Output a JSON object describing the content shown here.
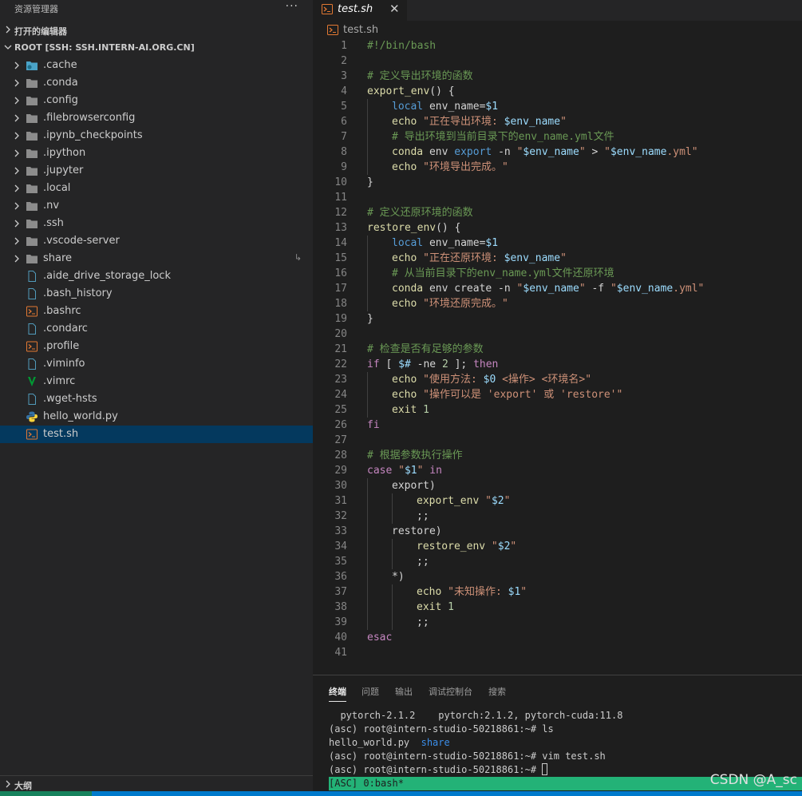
{
  "colors": {
    "accent": "#007acc",
    "selection": "#04395e",
    "tmux_bar": "#23b277",
    "remote": "#16825d"
  },
  "sidebar": {
    "title": "资源管理器",
    "more": "···",
    "open_editors": "打开的编辑器",
    "root": "ROOT [SSH: SSH.INTERN-AI.ORG.CN]",
    "outline": "大纲",
    "items": [
      {
        "name": ".cache",
        "type": "folder",
        "icon": "folder-cache-icon"
      },
      {
        "name": ".conda",
        "type": "folder",
        "icon": "folder-icon"
      },
      {
        "name": ".config",
        "type": "folder",
        "icon": "folder-icon"
      },
      {
        "name": ".filebrowserconfig",
        "type": "folder",
        "icon": "folder-icon"
      },
      {
        "name": ".ipynb_checkpoints",
        "type": "folder",
        "icon": "folder-icon"
      },
      {
        "name": ".ipython",
        "type": "folder",
        "icon": "folder-icon"
      },
      {
        "name": ".jupyter",
        "type": "folder",
        "icon": "folder-icon"
      },
      {
        "name": ".local",
        "type": "folder",
        "icon": "folder-icon"
      },
      {
        "name": ".nv",
        "type": "folder",
        "icon": "folder-icon"
      },
      {
        "name": ".ssh",
        "type": "folder",
        "icon": "folder-icon"
      },
      {
        "name": ".vscode-server",
        "type": "folder",
        "icon": "folder-icon"
      },
      {
        "name": "share",
        "type": "folder",
        "icon": "folder-icon",
        "badge": "↳"
      },
      {
        "name": ".aide_drive_storage_lock",
        "type": "file",
        "icon": "file-icon"
      },
      {
        "name": ".bash_history",
        "type": "file",
        "icon": "file-icon"
      },
      {
        "name": ".bashrc",
        "type": "file",
        "icon": "shell-icon"
      },
      {
        "name": ".condarc",
        "type": "file",
        "icon": "file-icon"
      },
      {
        "name": ".profile",
        "type": "file",
        "icon": "shell-icon"
      },
      {
        "name": ".viminfo",
        "type": "file",
        "icon": "file-icon"
      },
      {
        "name": ".vimrc",
        "type": "file",
        "icon": "vim-icon"
      },
      {
        "name": ".wget-hsts",
        "type": "file",
        "icon": "file-icon"
      },
      {
        "name": "hello_world.py",
        "type": "file",
        "icon": "python-icon"
      },
      {
        "name": "test.sh",
        "type": "file",
        "icon": "shell-icon",
        "selected": true
      }
    ]
  },
  "editor": {
    "tab_name": "test.sh",
    "tab_close": "✕",
    "breadcrumb": "test.sh",
    "lines": [
      {
        "n": "1",
        "indent": 0,
        "tokens": [
          [
            "cm",
            "#!/bin/bash"
          ]
        ]
      },
      {
        "n": "2",
        "indent": 0,
        "tokens": []
      },
      {
        "n": "3",
        "indent": 0,
        "tokens": [
          [
            "cm",
            "# 定义导出环境的函数"
          ]
        ]
      },
      {
        "n": "4",
        "indent": 0,
        "tokens": [
          [
            "fn",
            "export_env"
          ],
          [
            "pl",
            "() {"
          ]
        ]
      },
      {
        "n": "5",
        "indent": 1,
        "tokens": [
          [
            "bl",
            "local"
          ],
          [
            "pl",
            " env_name="
          ],
          [
            "var",
            "$1"
          ]
        ]
      },
      {
        "n": "6",
        "indent": 1,
        "tokens": [
          [
            "fn",
            "echo"
          ],
          [
            "pl",
            " "
          ],
          [
            "str",
            "\"正在导出环境: "
          ],
          [
            "var",
            "$env_name"
          ],
          [
            "str",
            "\""
          ]
        ]
      },
      {
        "n": "7",
        "indent": 1,
        "tokens": [
          [
            "cm",
            "# 导出环境到当前目录下的env_name.yml文件"
          ]
        ]
      },
      {
        "n": "8",
        "indent": 1,
        "tokens": [
          [
            "fn",
            "conda"
          ],
          [
            "pl",
            " env "
          ],
          [
            "bl",
            "export"
          ],
          [
            "pl",
            " -n "
          ],
          [
            "str",
            "\""
          ],
          [
            "var",
            "$env_name"
          ],
          [
            "str",
            "\""
          ],
          [
            "pl",
            " > "
          ],
          [
            "str",
            "\""
          ],
          [
            "var",
            "$env_name"
          ],
          [
            "str",
            ".yml\""
          ]
        ]
      },
      {
        "n": "9",
        "indent": 1,
        "tokens": [
          [
            "fn",
            "echo"
          ],
          [
            "pl",
            " "
          ],
          [
            "str",
            "\"环境导出完成。\""
          ]
        ]
      },
      {
        "n": "10",
        "indent": 0,
        "tokens": [
          [
            "pl",
            "}"
          ]
        ]
      },
      {
        "n": "11",
        "indent": 0,
        "tokens": []
      },
      {
        "n": "12",
        "indent": 0,
        "tokens": [
          [
            "cm",
            "# 定义还原环境的函数"
          ]
        ]
      },
      {
        "n": "13",
        "indent": 0,
        "tokens": [
          [
            "fn",
            "restore_env"
          ],
          [
            "pl",
            "() {"
          ]
        ]
      },
      {
        "n": "14",
        "indent": 1,
        "tokens": [
          [
            "bl",
            "local"
          ],
          [
            "pl",
            " env_name="
          ],
          [
            "var",
            "$1"
          ]
        ]
      },
      {
        "n": "15",
        "indent": 1,
        "tokens": [
          [
            "fn",
            "echo"
          ],
          [
            "pl",
            " "
          ],
          [
            "str",
            "\"正在还原环境: "
          ],
          [
            "var",
            "$env_name"
          ],
          [
            "str",
            "\""
          ]
        ]
      },
      {
        "n": "16",
        "indent": 1,
        "tokens": [
          [
            "cm",
            "# 从当前目录下的env_name.yml文件还原环境"
          ]
        ]
      },
      {
        "n": "17",
        "indent": 1,
        "tokens": [
          [
            "fn",
            "conda"
          ],
          [
            "pl",
            " env create -n "
          ],
          [
            "str",
            "\""
          ],
          [
            "var",
            "$env_name"
          ],
          [
            "str",
            "\""
          ],
          [
            "pl",
            " -f "
          ],
          [
            "str",
            "\""
          ],
          [
            "var",
            "$env_name"
          ],
          [
            "str",
            ".yml\""
          ]
        ]
      },
      {
        "n": "18",
        "indent": 1,
        "tokens": [
          [
            "fn",
            "echo"
          ],
          [
            "pl",
            " "
          ],
          [
            "str",
            "\"环境还原完成。\""
          ]
        ]
      },
      {
        "n": "19",
        "indent": 0,
        "tokens": [
          [
            "pl",
            "}"
          ]
        ]
      },
      {
        "n": "20",
        "indent": 0,
        "tokens": []
      },
      {
        "n": "21",
        "indent": 0,
        "tokens": [
          [
            "cm",
            "# 检查是否有足够的参数"
          ]
        ]
      },
      {
        "n": "22",
        "indent": 0,
        "tokens": [
          [
            "kw",
            "if"
          ],
          [
            "pl",
            " [ "
          ],
          [
            "var",
            "$#"
          ],
          [
            "pl",
            " -ne "
          ],
          [
            "num",
            "2"
          ],
          [
            "pl",
            " ]; "
          ],
          [
            "kw",
            "then"
          ]
        ]
      },
      {
        "n": "23",
        "indent": 1,
        "tokens": [
          [
            "fn",
            "echo"
          ],
          [
            "pl",
            " "
          ],
          [
            "str",
            "\"使用方法: "
          ],
          [
            "var",
            "$0"
          ],
          [
            "str",
            " <操作> <环境名>\""
          ]
        ]
      },
      {
        "n": "24",
        "indent": 1,
        "tokens": [
          [
            "fn",
            "echo"
          ],
          [
            "pl",
            " "
          ],
          [
            "str",
            "\"操作可以是 'export' 或 'restore'\""
          ]
        ]
      },
      {
        "n": "25",
        "indent": 1,
        "tokens": [
          [
            "fn",
            "exit"
          ],
          [
            "pl",
            " "
          ],
          [
            "num",
            "1"
          ]
        ]
      },
      {
        "n": "26",
        "indent": 0,
        "tokens": [
          [
            "kw",
            "fi"
          ]
        ]
      },
      {
        "n": "27",
        "indent": 0,
        "tokens": []
      },
      {
        "n": "28",
        "indent": 0,
        "tokens": [
          [
            "cm",
            "# 根据参数执行操作"
          ]
        ]
      },
      {
        "n": "29",
        "indent": 0,
        "tokens": [
          [
            "kw",
            "case"
          ],
          [
            "pl",
            " "
          ],
          [
            "str",
            "\""
          ],
          [
            "var",
            "$1"
          ],
          [
            "str",
            "\""
          ],
          [
            "pl",
            " "
          ],
          [
            "kw",
            "in"
          ]
        ]
      },
      {
        "n": "30",
        "indent": 1,
        "tokens": [
          [
            "pl",
            "export)"
          ]
        ]
      },
      {
        "n": "31",
        "indent": 2,
        "tokens": [
          [
            "fn",
            "export_env"
          ],
          [
            "pl",
            " "
          ],
          [
            "str",
            "\""
          ],
          [
            "var",
            "$2"
          ],
          [
            "str",
            "\""
          ]
        ]
      },
      {
        "n": "32",
        "indent": 2,
        "tokens": [
          [
            "pl",
            ";;"
          ]
        ]
      },
      {
        "n": "33",
        "indent": 1,
        "tokens": [
          [
            "pl",
            "restore)"
          ]
        ]
      },
      {
        "n": "34",
        "indent": 2,
        "tokens": [
          [
            "fn",
            "restore_env"
          ],
          [
            "pl",
            " "
          ],
          [
            "str",
            "\""
          ],
          [
            "var",
            "$2"
          ],
          [
            "str",
            "\""
          ]
        ]
      },
      {
        "n": "35",
        "indent": 2,
        "tokens": [
          [
            "pl",
            ";;"
          ]
        ]
      },
      {
        "n": "36",
        "indent": 1,
        "tokens": [
          [
            "pl",
            "*)"
          ]
        ]
      },
      {
        "n": "37",
        "indent": 2,
        "tokens": [
          [
            "fn",
            "echo"
          ],
          [
            "pl",
            " "
          ],
          [
            "str",
            "\"未知操作: "
          ],
          [
            "var",
            "$1"
          ],
          [
            "str",
            "\""
          ]
        ]
      },
      {
        "n": "38",
        "indent": 2,
        "tokens": [
          [
            "fn",
            "exit"
          ],
          [
            "pl",
            " "
          ],
          [
            "num",
            "1"
          ]
        ]
      },
      {
        "n": "39",
        "indent": 2,
        "tokens": [
          [
            "pl",
            ";;"
          ]
        ]
      },
      {
        "n": "40",
        "indent": 0,
        "tokens": [
          [
            "kw",
            "esac"
          ]
        ]
      },
      {
        "n": "41",
        "indent": 0,
        "tokens": []
      }
    ]
  },
  "panel": {
    "tabs": [
      "终端",
      "问题",
      "输出",
      "调试控制台",
      "搜索"
    ],
    "active_tab": 0,
    "terminal": {
      "line1": "  pytorch-2.1.2    pytorch:2.1.2, pytorch-cuda:11.8",
      "line2": "(asc) root@intern-studio-50218861:~# ls",
      "line3_file": "hello_world.py",
      "line3_sep": "  ",
      "line3_dir": "share",
      "line4": "(asc) root@intern-studio-50218861:~# vim test.sh",
      "line5": "(asc) root@intern-studio-50218861:~# "
    },
    "tmux_status": "[ASC] 0:bash*",
    "watermark": "CSDN @A_sc"
  }
}
